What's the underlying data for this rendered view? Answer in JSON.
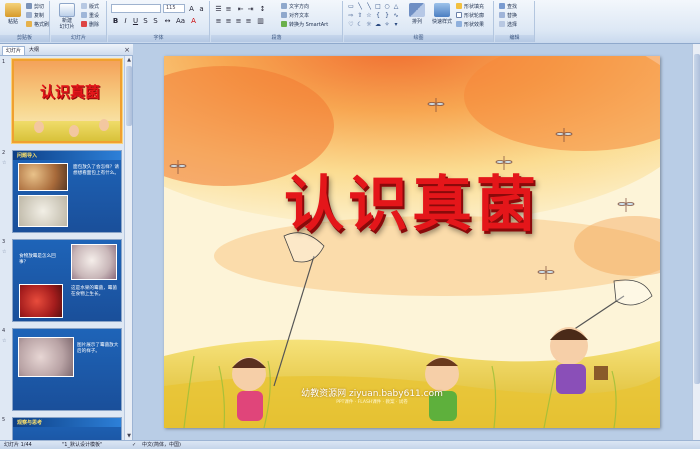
{
  "ribbon": {
    "groups": {
      "clipboard": "剪贴板",
      "slides": "幻灯片",
      "font": "字体",
      "paragraph": "段落",
      "drawing": "绘图",
      "editing": "编辑"
    },
    "paste": "粘贴",
    "cut": "剪切",
    "copy": "复制",
    "format_painter": "格式刷",
    "new_slide": "新建\n幻灯片",
    "layout": "版式",
    "reset": "重设",
    "delete": "删除",
    "font_size": "115",
    "text_direction": "文字方向",
    "align_text": "对齐文本",
    "smartart": "转换为 SmartArt",
    "arrange": "排列",
    "quick_styles": "快速样式",
    "shape_fill": "形状填充",
    "shape_outline": "形状轮廓",
    "shape_effects": "形状效果",
    "find": "查找",
    "replace": "替换",
    "select": "选择"
  },
  "left_panel": {
    "tab_slides": "幻灯片",
    "tab_outline": "大纲",
    "close": "×",
    "thumbnails": [
      {
        "num": "1",
        "title": "认识真菌"
      },
      {
        "num": "2",
        "head": "问题导入",
        "text": "面包放久了会怎样？请想想看面包上有什么。"
      },
      {
        "num": "3",
        "head": "",
        "text1": "食物放霉是怎么回事？",
        "text2": "这是水果的霉菌，霉菌在食物上生长。"
      },
      {
        "num": "4",
        "head": "",
        "text": "图片展示了霉菌放大后的样子。"
      },
      {
        "num": "5",
        "head": "观察与思考"
      }
    ]
  },
  "slide": {
    "title": "认识真菌",
    "watermark": "幼教资源网 ziyuan.baby611.com",
    "watermark_sub": "PPT课件 · FLASH课件 · 教案 · 试卷"
  },
  "statusbar": {
    "slide_info": "幻灯片 1/44",
    "theme": "\"1_默认设计模板\"",
    "language": "中文(简体，中国)"
  },
  "colors": {
    "title_red": "#e4161a",
    "ribbon_bg": "#dde8f5",
    "selection": "#f0a030"
  }
}
